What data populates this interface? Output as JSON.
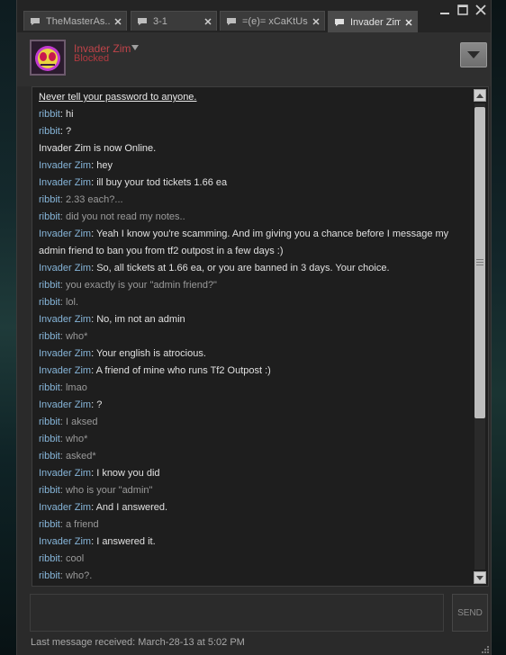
{
  "tabs": [
    {
      "label": "TheMasterAs..."
    },
    {
      "label": "3-1"
    },
    {
      "label": "=(e)= xCaKtUs"
    },
    {
      "label": "Invader Zim"
    }
  ],
  "header": {
    "friend_name": "Invader Zim",
    "friend_status": "Blocked"
  },
  "messages": [
    {
      "type": "warning",
      "text": "Never tell your password to anyone."
    },
    {
      "type": "chat",
      "sender": "ribbit",
      "text": "hi"
    },
    {
      "type": "chat",
      "sender": "ribbit",
      "text": "?"
    },
    {
      "type": "system",
      "text": "Invader Zim is now Online."
    },
    {
      "type": "chat",
      "sender": "Invader Zim",
      "text": "hey"
    },
    {
      "type": "chat",
      "sender": "Invader Zim",
      "text": "ill buy your tod tickets 1.66 ea"
    },
    {
      "type": "chat",
      "sender": "ribbit",
      "text": "2.33 each?...",
      "muted": true
    },
    {
      "type": "chat",
      "sender": "ribbit",
      "text": "did you not read my notes..",
      "muted": true
    },
    {
      "type": "chat",
      "sender": "Invader Zim",
      "text": "Yeah I know you're scamming. And im giving you a chance before I message my"
    },
    {
      "type": "continuation",
      "text": "admin friend to ban you from tf2 outpost in a few days :)"
    },
    {
      "type": "chat",
      "sender": "Invader Zim",
      "text": "So, all tickets at 1.66 ea, or you are banned in 3 days. Your choice."
    },
    {
      "type": "chat",
      "sender": "ribbit",
      "text": "you exactly is your \"admin friend?\"",
      "muted": true
    },
    {
      "type": "chat",
      "sender": "ribbit",
      "text": "lol.",
      "muted": true
    },
    {
      "type": "chat",
      "sender": "Invader Zim",
      "text": "No, im not an admin"
    },
    {
      "type": "chat",
      "sender": "ribbit",
      "text": "who*",
      "muted": true
    },
    {
      "type": "chat",
      "sender": "Invader Zim",
      "text": "Your english is atrocious."
    },
    {
      "type": "chat",
      "sender": "Invader Zim",
      "text": "A friend of mine who runs Tf2 Outpost :)"
    },
    {
      "type": "chat",
      "sender": "ribbit",
      "text": "lmao",
      "muted": true
    },
    {
      "type": "chat",
      "sender": "Invader Zim",
      "text": "?"
    },
    {
      "type": "chat",
      "sender": "ribbit",
      "text": "I aksed",
      "muted": true
    },
    {
      "type": "chat",
      "sender": "ribbit",
      "text": "who*",
      "muted": true
    },
    {
      "type": "chat",
      "sender": "ribbit",
      "text": "asked*",
      "muted": true
    },
    {
      "type": "chat",
      "sender": "Invader Zim",
      "text": "I know you did"
    },
    {
      "type": "chat",
      "sender": "ribbit",
      "text": "who is your \"admin\"",
      "muted": true
    },
    {
      "type": "chat",
      "sender": "Invader Zim",
      "text": "And I answered."
    },
    {
      "type": "chat",
      "sender": "ribbit",
      "text": "a friend",
      "muted": true
    },
    {
      "type": "chat",
      "sender": "Invader Zim",
      "text": "I answered it."
    },
    {
      "type": "chat",
      "sender": "ribbit",
      "text": "cool",
      "muted": true
    },
    {
      "type": "chat",
      "sender": "ribbit",
      "text": "who?.",
      "muted": true
    }
  ],
  "send_label": "SEND",
  "footer": {
    "last_message": "Last message received: March-28-13 at 5:02 PM"
  },
  "colors": {
    "sender": "#86b5d9",
    "blocked": "#b23a40",
    "window_bg": "#2a2a2a",
    "chat_bg": "#1e1e1e"
  }
}
